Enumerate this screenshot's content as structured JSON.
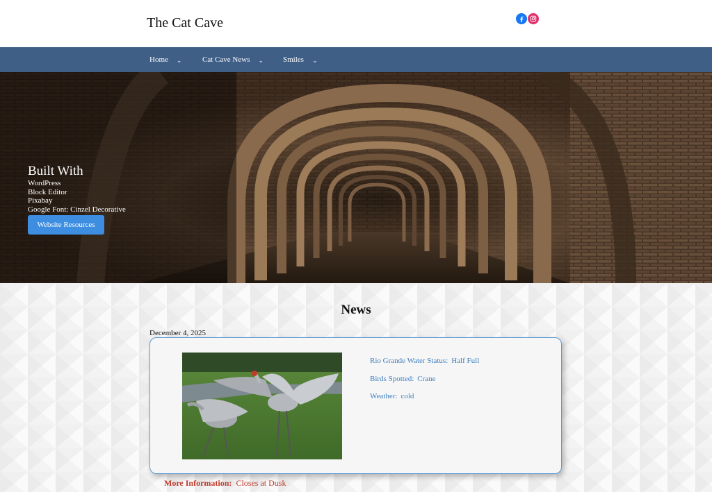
{
  "site": {
    "title": "The Cat Cave"
  },
  "social": {
    "facebook_icon": "facebook-icon",
    "instagram_icon": "instagram-icon",
    "facebook_color": "#1877f2",
    "instagram_color": "#e1306c"
  },
  "nav": {
    "background": "#3f5f86",
    "items": [
      {
        "label": "Home"
      },
      {
        "label": "Cat Cave News"
      },
      {
        "label": "Smiles"
      }
    ]
  },
  "hero": {
    "heading": "Built With",
    "lines": [
      "WordPress",
      "Block Editor",
      "Pixabay",
      "Google Font: Cinzel Decorative"
    ],
    "button_label": "Website Resources",
    "button_color": "#3d8ee0"
  },
  "news": {
    "heading": "News",
    "post": {
      "date": "December 4, 2025",
      "stats": [
        {
          "label": "Rio Grande Water Status:",
          "value": "Half Full"
        },
        {
          "label": "Birds Spotted:",
          "value": "Crane"
        },
        {
          "label": "Weather:",
          "value": "cold"
        }
      ],
      "more_info_label": "More Information:",
      "more_info_value": "Closes at Dusk"
    }
  }
}
